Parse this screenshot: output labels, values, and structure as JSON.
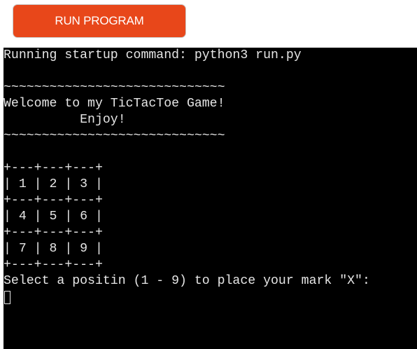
{
  "toolbar": {
    "run_label": "RUN PROGRAM"
  },
  "colors": {
    "run_button_bg": "#e8471a",
    "terminal_bg": "#000000",
    "terminal_fg": "#e6e6e6"
  },
  "terminal": {
    "lines": [
      "Running startup command: python3 run.py",
      "",
      "~~~~~~~~~~~~~~~~~~~~~~~~~~~~~",
      "Welcome to my TicTacToe Game!",
      "          Enjoy!",
      "~~~~~~~~~~~~~~~~~~~~~~~~~~~~~",
      "",
      "+---+---+---+",
      "| 1 | 2 | 3 |",
      "+---+---+---+",
      "| 4 | 5 | 6 |",
      "+---+---+---+",
      "| 7 | 8 | 9 |",
      "+---+---+---+",
      "Select a positin (1 - 9) to place your mark \"X\":"
    ]
  }
}
